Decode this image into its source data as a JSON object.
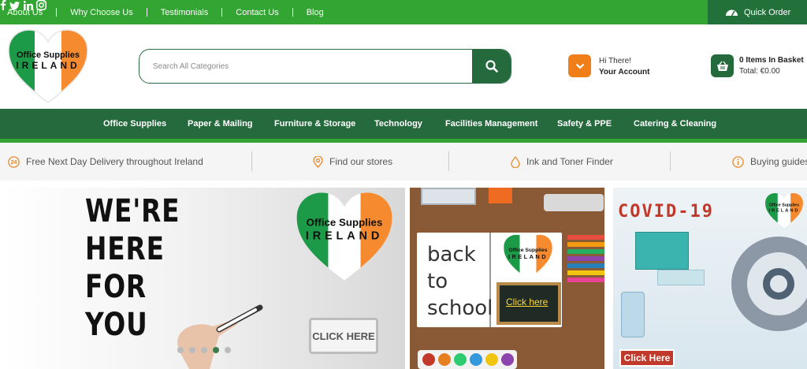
{
  "topbar": {
    "links": [
      {
        "label": "About Us"
      },
      {
        "label": "Why Choose Us"
      },
      {
        "label": "Testimonials"
      },
      {
        "label": "Contact Us"
      },
      {
        "label": "Blog"
      }
    ],
    "social_icons": [
      "facebook-icon",
      "twitter-icon",
      "linkedin-icon",
      "instagram-icon"
    ],
    "quick_order_label": "Quick Order",
    "bg_color": "#33a532"
  },
  "logo": {
    "line1": "Office Supplies",
    "line2": "IRELAND",
    "colors": {
      "green": "#1d9a47",
      "white": "#ffffff",
      "orange": "#f58a2f"
    }
  },
  "search": {
    "placeholder": "Search All Categories"
  },
  "account": {
    "greeting": "Hi There!",
    "label": "Your Account"
  },
  "basket": {
    "items_label": "0 Items In Basket",
    "total_label": "Total: €0.00"
  },
  "nav": {
    "items": [
      {
        "label": "Office Supplies"
      },
      {
        "label": "Paper & Mailing"
      },
      {
        "label": "Furniture & Storage"
      },
      {
        "label": "Technology"
      },
      {
        "label": "Facilities Management"
      },
      {
        "label": "Safety & PPE"
      },
      {
        "label": "Catering & Cleaning"
      }
    ],
    "bg_color": "#256a3d"
  },
  "info_strip": {
    "items": [
      {
        "icon": "24-hour-icon",
        "label": "Free Next Day Delivery throughout Ireland"
      },
      {
        "icon": "location-pin-icon",
        "label": "Find our stores"
      },
      {
        "icon": "ink-drop-icon",
        "label": "Ink and Toner Finder"
      },
      {
        "icon": "info-icon",
        "label": "Buying guides"
      }
    ],
    "icon_color": "#e8892b"
  },
  "banners": {
    "main": {
      "headline_lines": [
        "WE'RE",
        "HERE",
        "FOR",
        "YOU"
      ],
      "cta_label": "CLICK HERE",
      "logo_line1": "Office Supplies",
      "logo_line2": "IRELAND",
      "carousel_dots": 5,
      "active_dot": 3
    },
    "back_to_school": {
      "text_lines": [
        "back",
        "to",
        "school"
      ],
      "cta_label": "Click here",
      "logo_line1": "Office Supplies",
      "logo_line2": "IRELAND"
    },
    "covid": {
      "headline": "COVID-19",
      "cta_label": "Click Here",
      "logo_line1": "Office Supplies",
      "logo_line2": "IRELAND"
    }
  }
}
